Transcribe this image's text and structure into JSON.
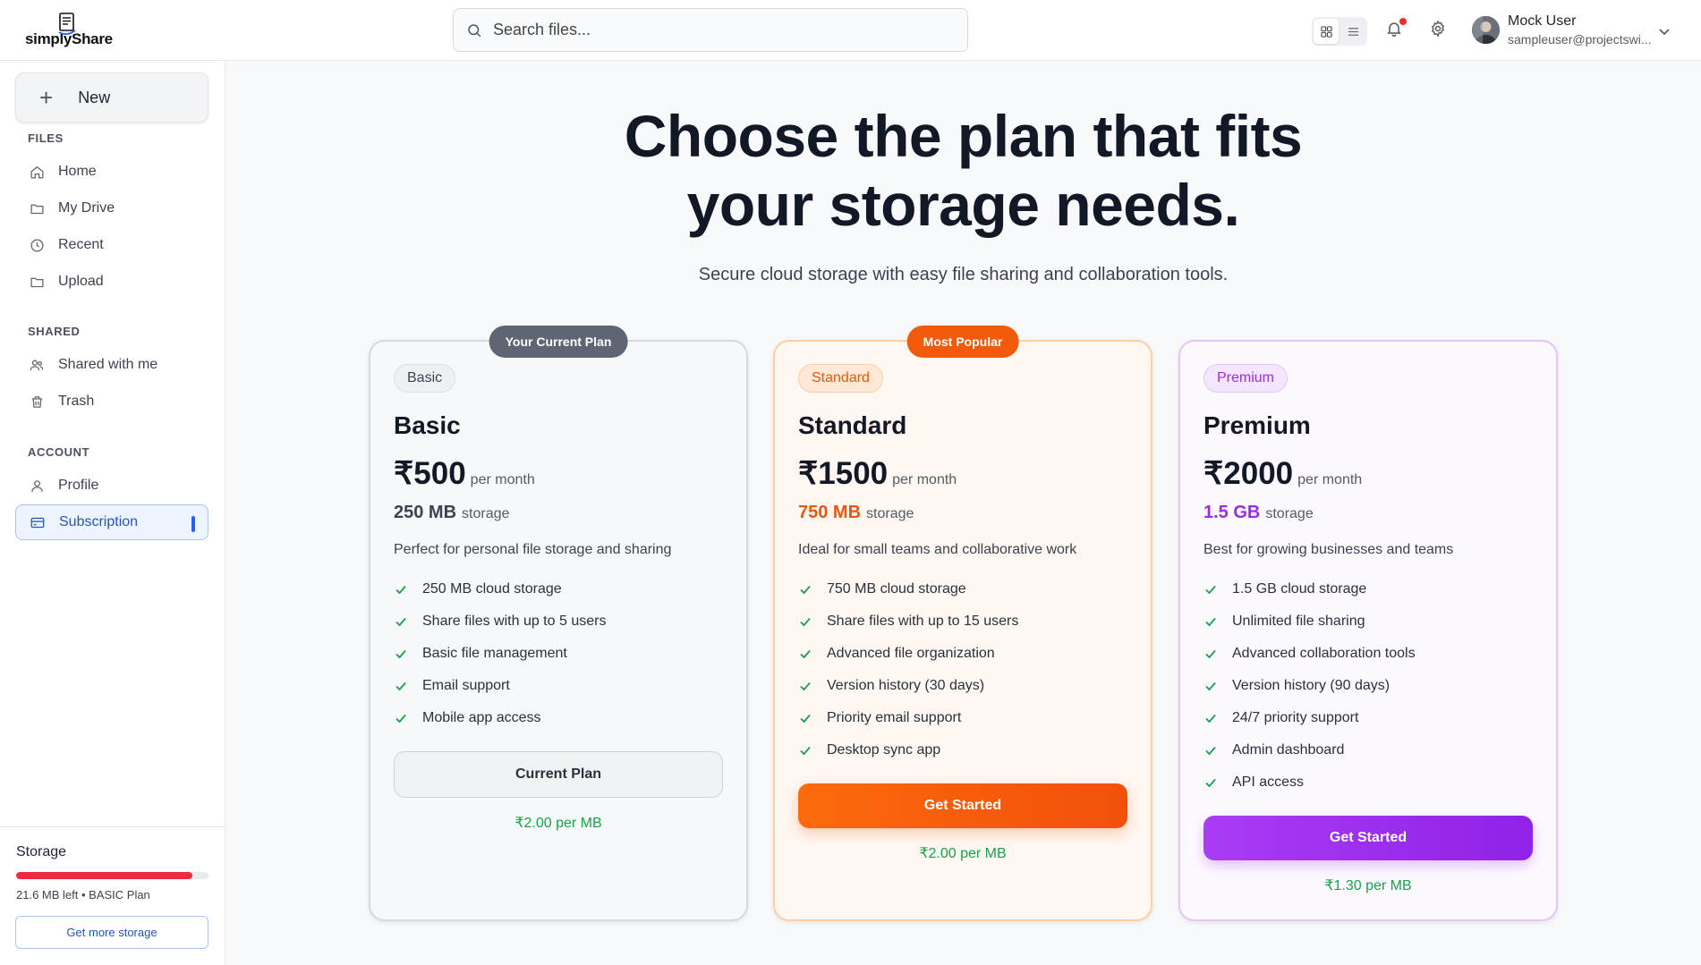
{
  "app": {
    "logo_text": "simplyShare"
  },
  "header": {
    "search_placeholder": "Search files...",
    "user_name": "Mock User",
    "user_email": "sampleuser@projectswi..."
  },
  "sidebar": {
    "new_label": "New",
    "sections": {
      "files": "FILES",
      "shared": "SHARED",
      "account": "ACCOUNT"
    },
    "items": [
      {
        "label": "Home",
        "icon": "home-icon"
      },
      {
        "label": "My Drive",
        "icon": "folder-icon"
      },
      {
        "label": "Recent",
        "icon": "clock-icon"
      },
      {
        "label": "Upload",
        "icon": "folder-icon"
      },
      {
        "label": "Shared with me",
        "icon": "users-icon"
      },
      {
        "label": "Trash",
        "icon": "trash-icon"
      },
      {
        "label": "Profile",
        "icon": "user-icon"
      },
      {
        "label": "Subscription",
        "icon": "credit-card-icon",
        "active": true
      }
    ],
    "storage": {
      "title": "Storage",
      "used_fraction": 0.914,
      "info": "21.6 MB left • BASIC Plan",
      "cta": "Get more storage",
      "bar_color": "#ef2b3d"
    }
  },
  "hero": {
    "title_line1": "Choose the plan that fits",
    "title_line2": "your storage needs.",
    "subtitle": "Secure cloud storage with easy file sharing and collaboration tools."
  },
  "plans": [
    {
      "flag": "Your Current Plan",
      "pill": "Basic",
      "name": "Basic",
      "price": "₹500",
      "per": "per month",
      "storage": "250 MB",
      "storage_label": "storage",
      "description": "Perfect for personal file storage and sharing",
      "features": [
        "250 MB cloud storage",
        "Share files with up to 5 users",
        "Basic file management",
        "Email support",
        "Mobile app access"
      ],
      "cta": "Current Plan",
      "per_mb": "₹2.00 per MB"
    },
    {
      "flag": "Most Popular",
      "pill": "Standard",
      "name": "Standard",
      "price": "₹1500",
      "per": "per month",
      "storage": "750 MB",
      "storage_label": "storage",
      "description": "Ideal for small teams and collaborative work",
      "features": [
        "750 MB cloud storage",
        "Share files with up to 15 users",
        "Advanced file organization",
        "Version history (30 days)",
        "Priority email support",
        "Desktop sync app"
      ],
      "cta": "Get Started",
      "per_mb": "₹2.00 per MB"
    },
    {
      "pill": "Premium",
      "name": "Premium",
      "price": "₹2000",
      "per": "per month",
      "storage": "1.5 GB",
      "storage_label": "storage",
      "description": "Best for growing businesses and teams",
      "features": [
        "1.5 GB cloud storage",
        "Unlimited file sharing",
        "Advanced collaboration tools",
        "Version history (90 days)",
        "24/7 priority support",
        "Admin dashboard",
        "API access"
      ],
      "cta": "Get Started",
      "per_mb": "₹1.30 per MB"
    }
  ],
  "colors": {
    "accent_orange": "#f25a0b",
    "accent_purple": "#9d2ae8",
    "accent_blue": "#2563eb",
    "check_green": "#16a34a"
  }
}
